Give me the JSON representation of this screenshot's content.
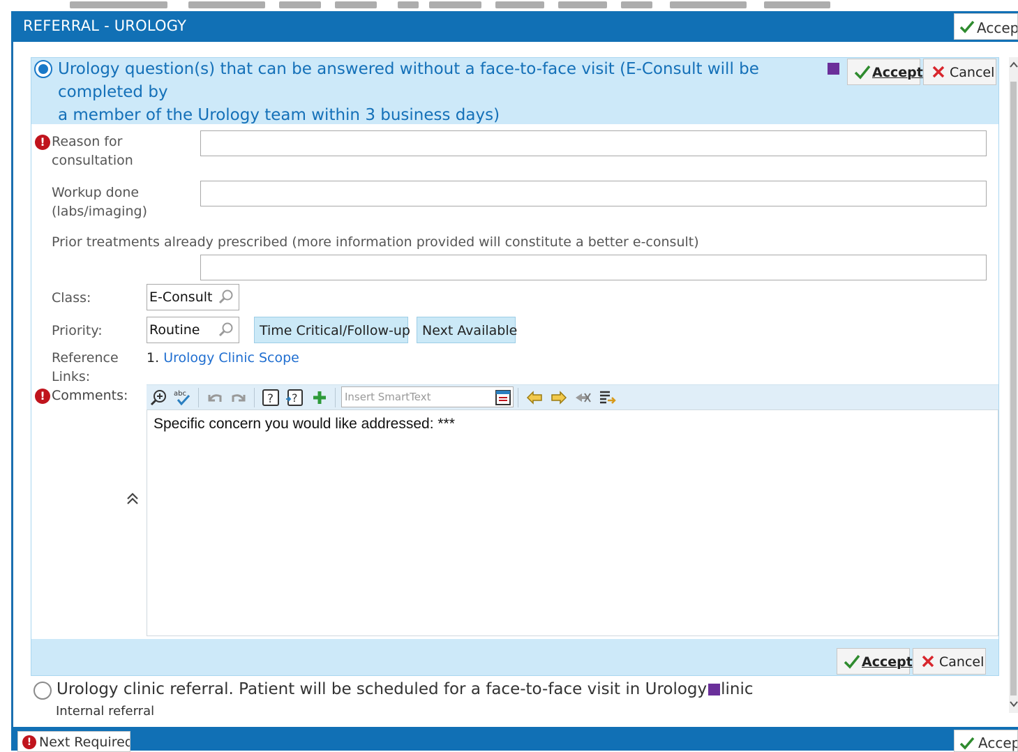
{
  "window": {
    "title": "REFERRAL - UROLOGY",
    "accept_label": "Accept"
  },
  "option1": {
    "text_line1": "Urology question(s) that can be answered without a face-to-face visit (E-Consult will be completed by",
    "text_line2": "a member of the Urology team within 3 business days)",
    "selected": true,
    "accept_label": "Accept",
    "cancel_label": "Cancel"
  },
  "form": {
    "reason_label_1": "Reason for",
    "reason_label_2": "consultation",
    "reason_value": "",
    "workup_label_1": "Workup done",
    "workup_label_2": "(labs/imaging)",
    "workup_value": "",
    "prior_label": "Prior treatments already prescribed (more information provided will constitute a better e-consult)",
    "prior_value": "",
    "class_label": "Class:",
    "class_value": "E-Consult",
    "priority_label": "Priority:",
    "priority_value": "Routine",
    "priority_chip_1": "Time Critical/Follow-up",
    "priority_chip_2": "Next Available",
    "reference_label_1": "Reference",
    "reference_label_2": "Links:",
    "reference_number": "1.",
    "reference_link": "Urology Clinic Scope",
    "comments_label": "Comments:",
    "smarttext_placeholder": "Insert SmartText",
    "comments_text": "Specific concern you would like addressed: ***",
    "bottom_accept_label": "Accept",
    "bottom_cancel_label": "Cancel"
  },
  "option2": {
    "text": "Urology clinic referral.  Patient will be scheduled for a face-to-face visit in Urology clinic",
    "subtext": "Internal referral",
    "selected": false
  },
  "footer": {
    "next_required_label": "Next Required",
    "accept_label": "Accept"
  },
  "colors": {
    "header_blue": "#1170b5",
    "panel_blue": "#cde9f9",
    "link_blue": "#1f6ed0",
    "error_red": "#c0141d",
    "marker_purple": "#6a2f9a"
  }
}
